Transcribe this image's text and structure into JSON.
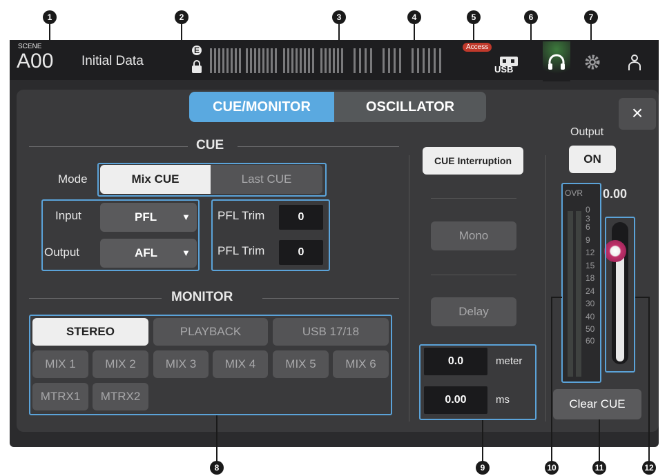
{
  "header": {
    "scene_label": "SCENE",
    "scene_number": "A00",
    "scene_name": "Initial Data",
    "access_badge": "Access",
    "usb_label": "USB",
    "icons": [
      "e-icon",
      "lock-icon",
      "usb-icon",
      "headphones-icon",
      "gear-icon",
      "user-icon"
    ]
  },
  "tabs": [
    {
      "label": "CUE/MONITOR",
      "active": true
    },
    {
      "label": "OSCILLATOR",
      "active": false
    }
  ],
  "cue": {
    "title": "CUE",
    "mode_label": "Mode",
    "mode_options": [
      "Mix CUE",
      "Last CUE"
    ],
    "mode_selected": "Mix CUE",
    "input_label": "Input",
    "input_value": "PFL",
    "output_label": "Output",
    "output_value": "AFL",
    "pfl_trim_label_1": "PFL Trim",
    "pfl_trim_value_1": "0",
    "pfl_trim_label_2": "PFL Trim",
    "pfl_trim_value_2": "0"
  },
  "monitor": {
    "title": "MONITOR",
    "sources_row1": [
      "STEREO",
      "PLAYBACK",
      "USB 17/18"
    ],
    "sources_row2": [
      "MIX 1",
      "MIX 2",
      "MIX 3",
      "MIX 4",
      "MIX 5",
      "MIX 6"
    ],
    "sources_row3": [
      "MTRX1",
      "MTRX2"
    ],
    "selected": "STEREO"
  },
  "middle": {
    "cue_interruption": "CUE Interruption",
    "mono": "Mono",
    "delay": "Delay",
    "delay_meter_value": "0.0",
    "delay_meter_unit": "meter",
    "delay_ms_value": "0.00",
    "delay_ms_unit": "ms"
  },
  "right": {
    "close": "×",
    "output_label": "Output",
    "output_button": "ON",
    "level_value": "0.00",
    "ovr_label": "OVR",
    "meter_scale": [
      "0",
      "3",
      "6",
      "9",
      "12",
      "15",
      "18",
      "24",
      "30",
      "40",
      "50",
      "60"
    ],
    "fader_level": 0.0,
    "clear_cue": "Clear CUE"
  },
  "callouts": [
    "1",
    "2",
    "3",
    "4",
    "5",
    "6",
    "7",
    "8",
    "9",
    "10",
    "11",
    "12"
  ],
  "colors": {
    "accent_highlight": "#5ba3d9",
    "tab_active": "#5aa9e0",
    "access_badge": "#c0392b",
    "fader_knob": "#c0306a"
  }
}
